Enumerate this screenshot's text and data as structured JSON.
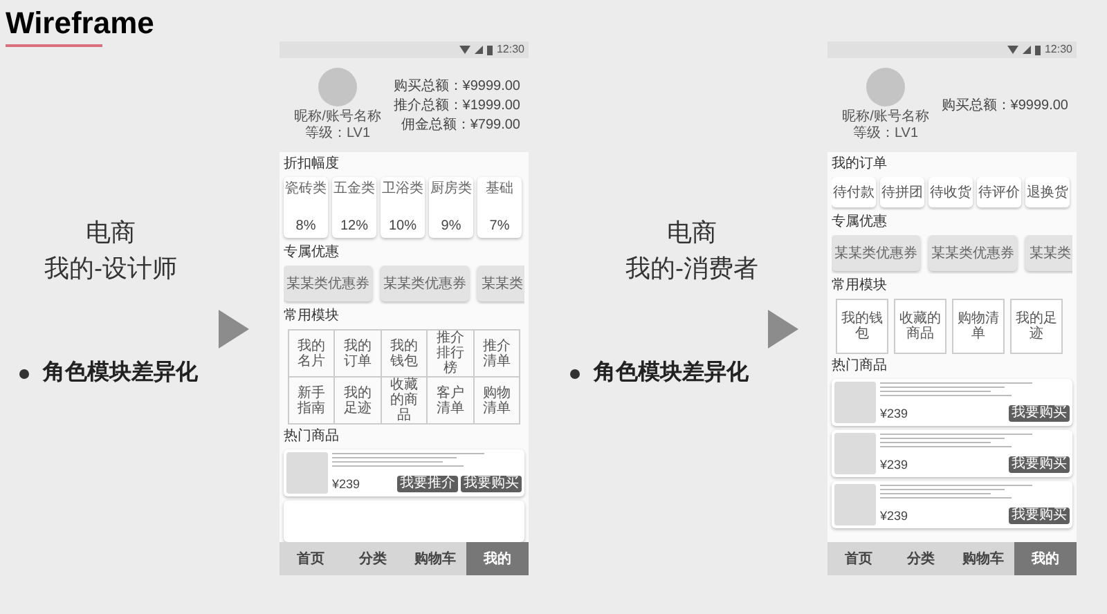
{
  "title": "Wireframe",
  "panels": [
    {
      "caption": [
        "电商",
        "我的-设计师"
      ],
      "bullet": "角色模块差异化",
      "phone": {
        "status_time": "12:30",
        "nickname": "昵称/账号名称",
        "level_text": "等级：LV1",
        "stats": [
          "购买总额：¥9999.00",
          "推介总额：¥1999.00",
          "佣金总额：¥799.00"
        ],
        "sections": [
          {
            "kind": "discounts",
            "title": "折扣幅度",
            "items": [
              {
                "label": "瓷砖类",
                "value": "8%"
              },
              {
                "label": "五金类",
                "value": "12%"
              },
              {
                "label": "卫浴类",
                "value": "10%"
              },
              {
                "label": "厨房类",
                "value": "9%"
              },
              {
                "label": "基础",
                "value": "7%"
              }
            ]
          },
          {
            "kind": "coupons",
            "title": "专属优惠",
            "items": [
              "某某类优惠券",
              "某某类优惠券",
              "某某类"
            ]
          },
          {
            "kind": "module_table",
            "title": "常用模块",
            "items": [
              "我的名片",
              "我的订单",
              "我的钱包",
              "推介排行榜",
              "推介清单",
              "新手指南",
              "我的足迹",
              "收藏的商品",
              "客户清单",
              "购物清单"
            ]
          },
          {
            "kind": "products",
            "title": "热门商品",
            "items": [
              {
                "price": "¥239",
                "buttons": [
                  "我要推介",
                  "我要购买"
                ]
              }
            ],
            "partial_card": true
          }
        ],
        "tabs": [
          {
            "label": "首页",
            "selected": false
          },
          {
            "label": "分类",
            "selected": false
          },
          {
            "label": "购物车",
            "selected": false
          },
          {
            "label": "我的",
            "selected": true
          }
        ]
      }
    },
    {
      "caption": [
        "电商",
        "我的-消费者"
      ],
      "bullet": "角色模块差异化",
      "phone": {
        "status_time": "12:30",
        "nickname": "昵称/账号名称",
        "level_text": "等级：LV1",
        "stats": [
          "购买总额：¥9999.00"
        ],
        "sections": [
          {
            "kind": "orders",
            "title": "我的订单",
            "items": [
              "待付款",
              "待拼团",
              "待收货",
              "待评价",
              "退换货"
            ]
          },
          {
            "kind": "coupons",
            "title": "专属优惠",
            "items": [
              "某某类优惠券",
              "某某类优惠券",
              "某某类"
            ]
          },
          {
            "kind": "module_tiles",
            "title": "常用模块",
            "items": [
              "我的钱包",
              "收藏的商品",
              "购物清单",
              "我的足迹"
            ]
          },
          {
            "kind": "products",
            "title": "热门商品",
            "items": [
              {
                "price": "¥239",
                "buttons": [
                  "我要购买"
                ]
              },
              {
                "price": "¥239",
                "buttons": [
                  "我要购买"
                ]
              },
              {
                "price": "¥239",
                "buttons": [
                  "我要购买"
                ]
              }
            ],
            "partial_card": false
          }
        ],
        "tabs": [
          {
            "label": "首页",
            "selected": false
          },
          {
            "label": "分类",
            "selected": false
          },
          {
            "label": "购物车",
            "selected": false
          },
          {
            "label": "我的",
            "selected": true
          }
        ]
      }
    }
  ]
}
